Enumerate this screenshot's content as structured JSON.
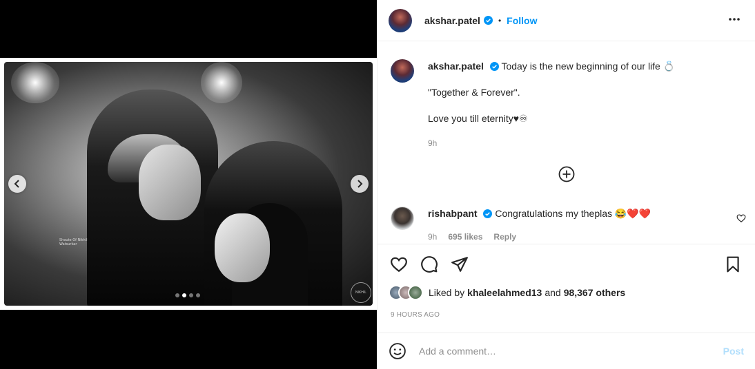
{
  "post": {
    "username": "akshar.patel",
    "follow_label": "Follow",
    "separator": "•",
    "media": {
      "watermark_text": "Shoute Of Nikhil Watsurkar",
      "watermark_seal": "NIKHIL",
      "slide_count": 4,
      "active_slide": 2
    },
    "caption": {
      "username": "akshar.patel",
      "line1": "Today is the new beginning of our life 💍",
      "line2": "\"Together & Forever\".",
      "line3": "Love you till eternity♥♾",
      "time": "9h"
    },
    "reply": {
      "username": "rishabpant",
      "text": "Congratulations my theplas 😂❤️❤️",
      "time": "9h",
      "likes": "695 likes",
      "reply_label": "Reply"
    },
    "likes": {
      "prefix": "Liked by",
      "user": "khaleelahmed13",
      "middle": "and",
      "count": "98,367 others"
    },
    "time_ago": "9 HOURS AGO",
    "comment": {
      "placeholder": "Add a comment…",
      "post_label": "Post"
    }
  },
  "colors": {
    "accent": "#0095f6",
    "post_disabled": "#b2dffc",
    "muted": "#8e8e8e",
    "text": "#262626",
    "heart_red": "#ed4956"
  }
}
